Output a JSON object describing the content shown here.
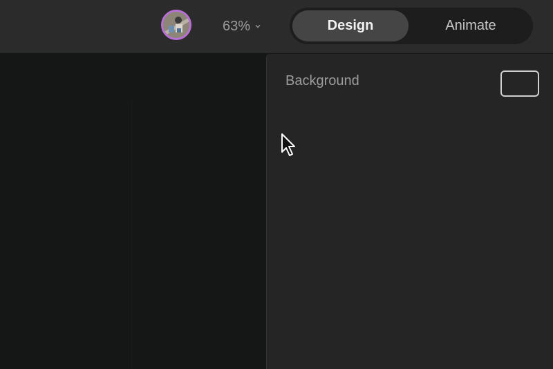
{
  "toolbar": {
    "zoom_label": "63%",
    "modes": [
      {
        "label": "Design",
        "active": true
      },
      {
        "label": "Animate",
        "active": false
      }
    ]
  },
  "inspector": {
    "background_label": "Background",
    "background_color": "#252525"
  },
  "colors": {
    "topbar": "#2b2b2b",
    "canvas": "#151716",
    "panel": "#252525",
    "avatar_ring": "#b86fd6"
  },
  "icons": {
    "avatar": "user-avatar",
    "zoom_dropdown": "chevron-down-icon",
    "pointer": "mouse-pointer-icon"
  }
}
